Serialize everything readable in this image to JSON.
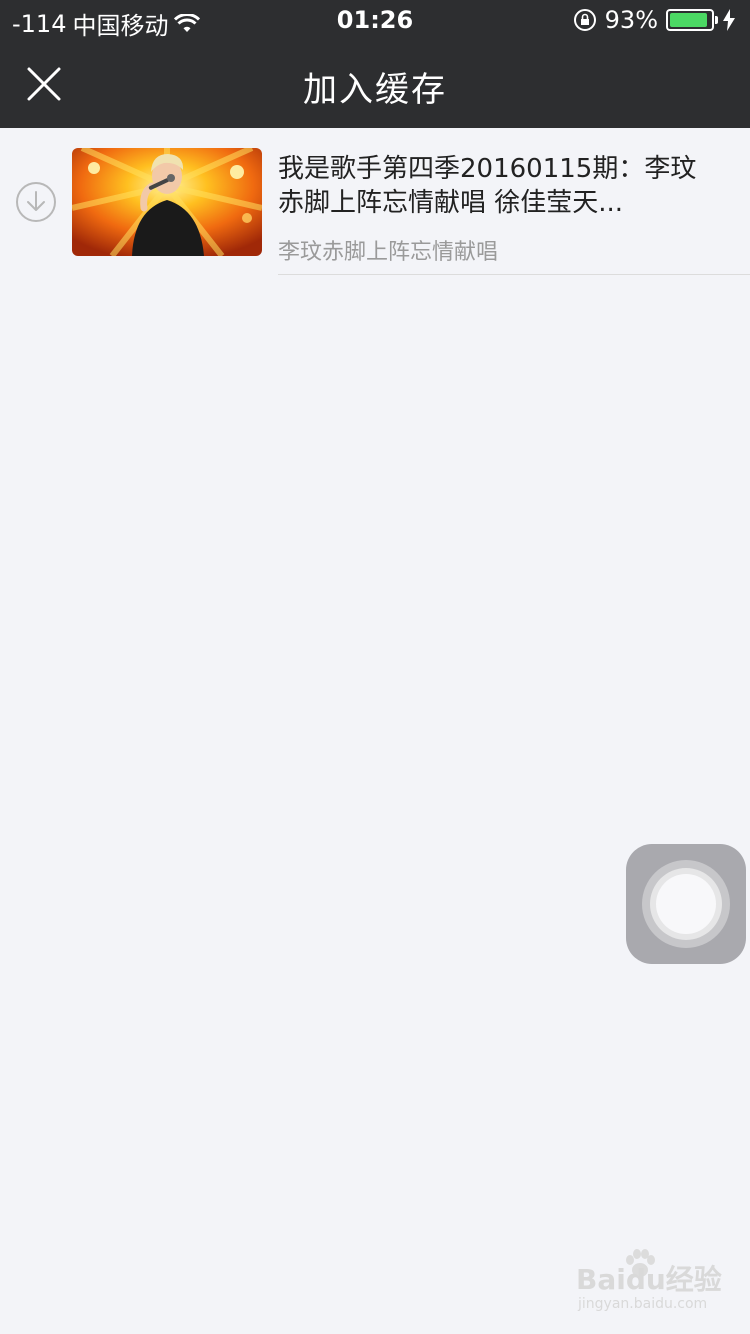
{
  "status_bar": {
    "signal": "-114",
    "carrier": "中国移动",
    "time": "01:26",
    "battery": "93%",
    "battery_level": 0.93
  },
  "navbar": {
    "title": "加入缓存",
    "close_icon": "close-icon"
  },
  "items": [
    {
      "title": "我是歌手第四季20160115期：李玟赤脚上阵忘情献唱 徐佳莹天...",
      "subtitle": "李玟赤脚上阵忘情献唱",
      "icon": "download-icon"
    }
  ],
  "watermark": {
    "main": "Baidu经验",
    "sub": "jingyan.baidu.com"
  },
  "colors": {
    "topbar": "#2d2e30",
    "background": "#f3f4f8",
    "battery": "#4cd964"
  }
}
